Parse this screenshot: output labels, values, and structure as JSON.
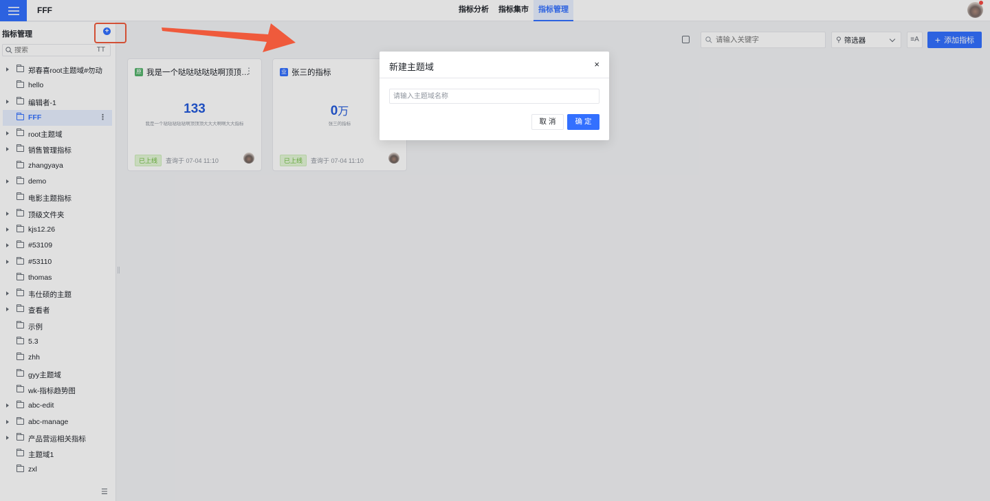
{
  "header": {
    "app_title": "FFF",
    "nav": [
      "指标分析",
      "指标集市",
      "指标管理"
    ],
    "active_nav": 2
  },
  "sidebar": {
    "title": "指标管理",
    "add_icon": "plus-circle-icon",
    "search_placeholder": "搜索",
    "text_toggle": "TT",
    "items": [
      {
        "label": "郑春喜root主题域#勿动",
        "expandable": true
      },
      {
        "label": "hello",
        "expandable": false
      },
      {
        "label": "编辑者-1",
        "expandable": true
      },
      {
        "label": "FFF",
        "expandable": false,
        "active": true
      },
      {
        "label": "root主题域",
        "expandable": true
      },
      {
        "label": "销售管理指标",
        "expandable": true
      },
      {
        "label": "zhangyaya",
        "expandable": false
      },
      {
        "label": "demo",
        "expandable": true
      },
      {
        "label": "电影主题指标",
        "expandable": false
      },
      {
        "label": "顶级文件夹",
        "expandable": true
      },
      {
        "label": "kjs12.26",
        "expandable": true
      },
      {
        "label": "#53109",
        "expandable": true
      },
      {
        "label": "#53110",
        "expandable": true
      },
      {
        "label": "thomas",
        "expandable": false
      },
      {
        "label": "韦仕硕的主题",
        "expandable": true
      },
      {
        "label": "查看者",
        "expandable": true
      },
      {
        "label": "示例",
        "expandable": false
      },
      {
        "label": "5.3",
        "expandable": false
      },
      {
        "label": "zhh",
        "expandable": false
      },
      {
        "label": "gyy主题域",
        "expandable": false
      },
      {
        "label": "wk-指标趋势图",
        "expandable": false
      },
      {
        "label": "abc-edit",
        "expandable": true
      },
      {
        "label": "abc-manage",
        "expandable": true
      },
      {
        "label": "产品营运相关指标",
        "expandable": true
      },
      {
        "label": "主题域1",
        "expandable": false
      },
      {
        "label": "zxl",
        "expandable": false
      }
    ]
  },
  "toolbar": {
    "search_placeholder": "请输入关键字",
    "filter_label": "筛选器",
    "add_metric_label": "添加指标",
    "sort_icon": "sort-az-icon"
  },
  "cards": [
    {
      "badge": "原",
      "badge_color": "#54b36b",
      "title": "我是一个哒哒哒哒哒啊顶顶顶大大大啊啊大大指标",
      "value": "133",
      "unit": "",
      "desc": "我是一个哒哒哒哒哒啊顶顶顶大大大啊啊大大指标",
      "status": "已上线",
      "query_time": "查询于 07-04 11:10"
    },
    {
      "badge": "业",
      "badge_color": "#3370ff",
      "title": "张三的指标",
      "value": "0",
      "unit": "万",
      "desc": "张三的指标",
      "status": "已上线",
      "query_time": "查询于 07-04 11:10"
    }
  ],
  "modal": {
    "title": "新建主题域",
    "input_placeholder": "请输入主题域名称",
    "cancel_label": "取 消",
    "ok_label": "确 定"
  },
  "colors": {
    "accent": "#3370ff",
    "annotation": "#ef5a3c"
  }
}
